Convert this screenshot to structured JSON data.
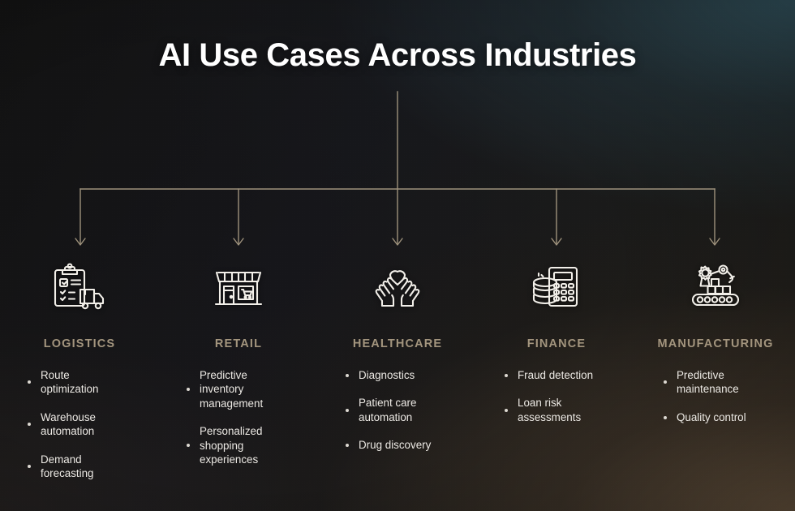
{
  "title": "AI Use Cases Across Industries",
  "theme": {
    "heading_color": "#a3957e",
    "bullet_text_color": "#ece9e4",
    "connector_color": "#9e927c",
    "icon_color": "#f2efe9",
    "background_dark": "#161514",
    "background_teal": "#345662",
    "background_warm": "#786046"
  },
  "columns": [
    {
      "heading": "LOGISTICS",
      "icon": "clipboard-truck-icon",
      "bullets": [
        "Route optimization",
        "Warehouse automation",
        "Demand forecasting"
      ]
    },
    {
      "heading": "RETAIL",
      "icon": "storefront-icon",
      "bullets": [
        "Predictive inventory management",
        "Personalized shopping experiences"
      ]
    },
    {
      "heading": "HEALTHCARE",
      "icon": "hands-heart-icon",
      "bullets": [
        "Diagnostics",
        "Patient care automation",
        "Drug discovery"
      ]
    },
    {
      "heading": "FINANCE",
      "icon": "calculator-coins-icon",
      "bullets": [
        "Fraud detection",
        "Loan risk assessments"
      ]
    },
    {
      "heading": "MANUFACTURING",
      "icon": "conveyor-robot-arm-icon",
      "bullets": [
        "Predictive maintenance",
        "Quality control"
      ]
    }
  ]
}
